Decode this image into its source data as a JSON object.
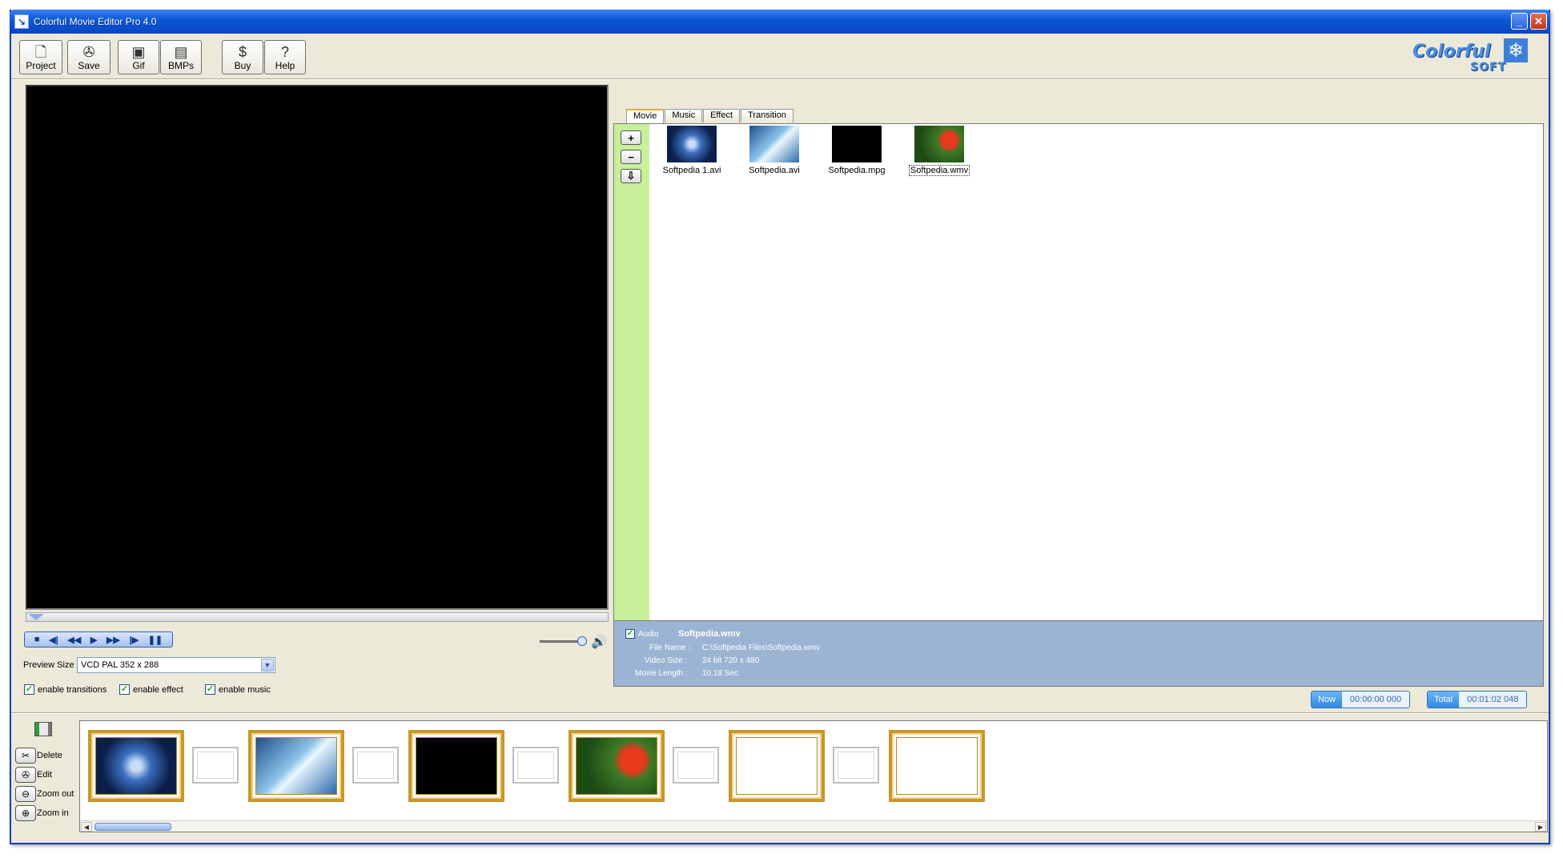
{
  "window": {
    "title": "Colorful Movie Editor Pro 4.0"
  },
  "toolbar": [
    {
      "label": "Project",
      "icon": "document-icon"
    },
    {
      "label": "Save",
      "icon": "film-reel-icon"
    },
    {
      "label": "Gif",
      "icon": "gif-icon"
    },
    {
      "label": "BMPs",
      "icon": "bmp-icon"
    },
    {
      "label": "Buy",
      "icon": "dollar-icon"
    },
    {
      "label": "Help",
      "icon": "question-icon"
    }
  ],
  "logo": {
    "line1": "Colorful",
    "line2": "SOFT"
  },
  "playback": {
    "controls": [
      "stop",
      "prev-frame",
      "rewind",
      "play",
      "fast-forward",
      "next-frame",
      "pause"
    ],
    "volume": 0.85
  },
  "preview_size": {
    "label": "Preview Size",
    "value": "VCD PAL 352 x 288"
  },
  "options": [
    {
      "label": "enable transitions",
      "checked": true
    },
    {
      "label": "enable effect",
      "checked": true
    },
    {
      "label": "enable music",
      "checked": true
    }
  ],
  "tabs": [
    {
      "label": "Movie",
      "active": true
    },
    {
      "label": "Music",
      "active": false
    },
    {
      "label": "Effect",
      "active": false
    },
    {
      "label": "Transition",
      "active": false
    }
  ],
  "side_buttons": [
    "+",
    "−",
    "⇩"
  ],
  "media": [
    {
      "name": "Softpedia 1.avi",
      "selected": false
    },
    {
      "name": "Softpedia.avi",
      "selected": false
    },
    {
      "name": "Softpedia.mpg",
      "selected": false
    },
    {
      "name": "Softpedia.wmv",
      "selected": true
    }
  ],
  "info": {
    "audio_label": "Audio",
    "audio_checked": true,
    "file_title": "Softpedia.wmv",
    "file_name_label": "File Name :",
    "file_name": "C:\\Softpedia Files\\Softpedia.wmv",
    "video_size_label": "Video Size :",
    "video_size": "24 bit  720 x 480",
    "movie_length_label": "Movie Length :",
    "movie_length": "10.18 Sec"
  },
  "time": {
    "now_label": "Now",
    "now_value": "00:00:00 000",
    "total_label": "Total",
    "total_value": "00:01:02 048"
  },
  "timeline_tools": [
    {
      "label": "Delete",
      "icon": "scissors-icon"
    },
    {
      "label": "Edit",
      "icon": "film-reel-icon"
    },
    {
      "label": "Zoom out",
      "icon": "zoom-out-icon"
    },
    {
      "label": "Zoom in",
      "icon": "zoom-in-icon"
    }
  ]
}
